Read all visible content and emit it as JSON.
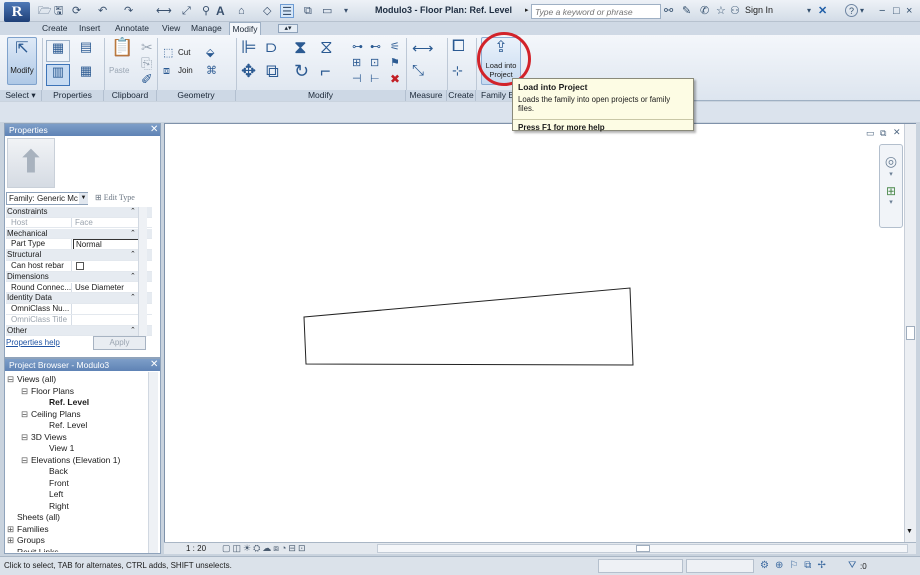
{
  "title_bar": {
    "app_letter": "R",
    "doc_title": "Modulo3 - Floor Plan: Ref. Level",
    "search_placeholder": "Type a keyword or phrase",
    "sign_in": "Sign In",
    "window_controls": [
      "−",
      "□",
      "×"
    ]
  },
  "tabs": [
    "Create",
    "Insert",
    "Annotate",
    "View",
    "Manage",
    "Modify"
  ],
  "active_tab": "Modify",
  "ribbon": {
    "modify_button": "Modify",
    "paste_button": "Paste",
    "cut": "Cut",
    "join": "Join",
    "load_into_project": "Load into Project",
    "panels": [
      "Select ▾",
      "Properties",
      "Clipboard",
      "Geometry",
      "Modify",
      "Measure",
      "Create",
      "Family Ed"
    ]
  },
  "tooltip": {
    "title": "Load into Project",
    "description": "Loads the family into open projects or family files.",
    "help": "Press F1 for more help"
  },
  "properties": {
    "title": "Properties",
    "type_selector": "Family: Generic Mc",
    "edit_type": "Edit Type",
    "rows": [
      {
        "name": "Constraints",
        "value": "",
        "category": true
      },
      {
        "name": "Host",
        "value": "Face",
        "dim": true
      },
      {
        "name": "Mechanical",
        "value": "",
        "category": true
      },
      {
        "name": "Part Type",
        "value": "Normal"
      },
      {
        "name": "Structural",
        "value": "",
        "category": true
      },
      {
        "name": "Can host rebar",
        "value": ""
      },
      {
        "name": "Dimensions",
        "value": "",
        "category": true
      },
      {
        "name": "Round Connec...",
        "value": "Use Diameter"
      },
      {
        "name": "Identity Data",
        "value": "",
        "category": true
      },
      {
        "name": "OmniClass Nu...",
        "value": ""
      },
      {
        "name": "OmniClass Title",
        "value": "",
        "dim": true
      },
      {
        "name": "Other",
        "value": "",
        "category": true
      }
    ],
    "help_link": "Properties help",
    "apply": "Apply"
  },
  "project_browser": {
    "title": "Project Browser - Modulo3",
    "nodes": [
      {
        "label": "Views (all)",
        "level": 0,
        "toggle": "⊟"
      },
      {
        "label": "Floor Plans",
        "level": 1,
        "toggle": "⊟"
      },
      {
        "label": "Ref. Level",
        "level": 2,
        "toggle": "",
        "bold": true
      },
      {
        "label": "Ceiling Plans",
        "level": 1,
        "toggle": "⊟"
      },
      {
        "label": "Ref. Level",
        "level": 2,
        "toggle": ""
      },
      {
        "label": "3D Views",
        "level": 1,
        "toggle": "⊟"
      },
      {
        "label": "View 1",
        "level": 2,
        "toggle": ""
      },
      {
        "label": "Elevations (Elevation 1)",
        "level": 1,
        "toggle": "⊟"
      },
      {
        "label": "Back",
        "level": 2,
        "toggle": ""
      },
      {
        "label": "Front",
        "level": 2,
        "toggle": ""
      },
      {
        "label": "Left",
        "level": 2,
        "toggle": ""
      },
      {
        "label": "Right",
        "level": 2,
        "toggle": ""
      },
      {
        "label": "Sheets (all)",
        "level": 0,
        "toggle": ""
      },
      {
        "label": "Families",
        "level": 0,
        "toggle": "⊞"
      },
      {
        "label": "Groups",
        "level": 0,
        "toggle": "⊞"
      },
      {
        "label": "Revit Links",
        "level": 0,
        "toggle": ""
      }
    ]
  },
  "view_bar": {
    "scale": "1 : 20"
  },
  "status_bar": {
    "hint": "Click to select, TAB for alternates, CTRL adds, SHIFT unselects.",
    "filter_count": ":0"
  }
}
